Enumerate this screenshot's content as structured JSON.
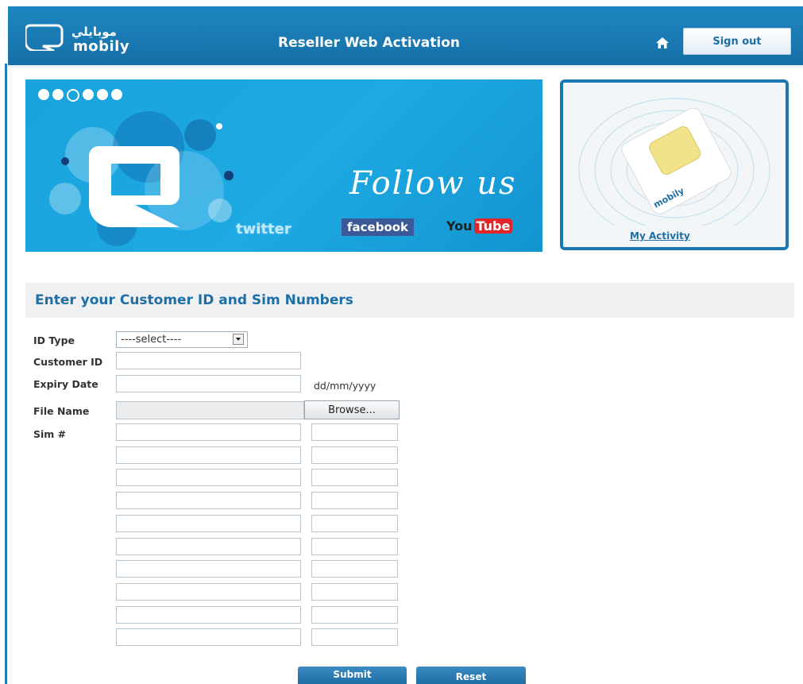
{
  "header": {
    "logo_arabic": "موبايلي",
    "logo_english": "mobily",
    "title": "Reseller Web Activation",
    "sign_out_label": "Sign out"
  },
  "banner": {
    "follow_text": "Follow us",
    "twitter_label": "twitter",
    "facebook_label": "facebook",
    "youtube_you": "You",
    "youtube_tube": "Tube",
    "slide_count": 6,
    "active_slide": 3
  },
  "activity": {
    "link_label": "My Activity",
    "sim_label": "mobily"
  },
  "form": {
    "section_title": "Enter your Customer ID and Sim Numbers",
    "id_type_label": "ID Type",
    "id_type_selected": "----select----",
    "customer_id_label": "Customer ID",
    "customer_id_value": "",
    "expiry_date_label": "Expiry Date",
    "expiry_date_value": "",
    "expiry_date_hint": "dd/mm/yyyy",
    "file_name_label": "File Name",
    "browse_label": "Browse...",
    "sim_label": "Sim #",
    "sim_rows": 10,
    "submit_label": "Submit",
    "reset_label": "Reset"
  },
  "colors": {
    "brand_blue": "#1d86c0",
    "section_title": "#1f6fa6",
    "banner_cyan": "#1ea9e3"
  }
}
